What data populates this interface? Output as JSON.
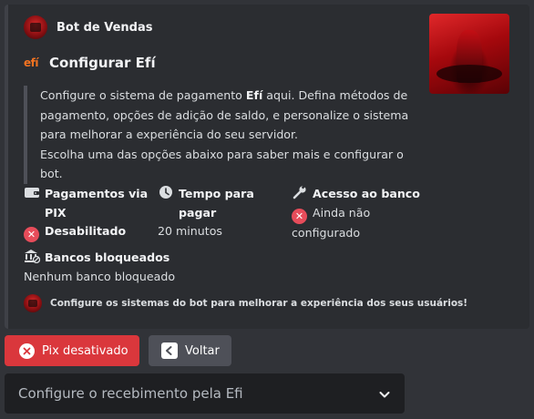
{
  "embed": {
    "author": "Bot de Vendas",
    "title_logo": "efí",
    "title": "Configurar Efí",
    "desc": {
      "p1": "Configure o sistema de pagamento ",
      "p1_bold": "Efí",
      "p1_rest": " aqui. Defina métodos de pagamento, opções de adição de saldo, e personalize o sistema para melhorar a experiência do seu servidor.",
      "p2": "Escolha uma das opções abaixo para saber mais e configurar o bot."
    },
    "fields": {
      "pix": {
        "name": "Pagamentos via PIX",
        "value": "Desabilitado",
        "value_icon": "x-circle-icon"
      },
      "tempo": {
        "name": "Tempo para pagar",
        "value": "20 minutos"
      },
      "acesso": {
        "name": "Acesso ao banco",
        "value": "Ainda não configurado",
        "value_icon": "x-circle-icon"
      },
      "bancos": {
        "name": "Bancos bloqueados",
        "value": "Nenhum banco bloqueado"
      }
    },
    "footer": "Configure os sistemas do bot para melhorar a experiência dos seus usuários!"
  },
  "buttons": {
    "pix": "Pix desativado",
    "back": "Voltar"
  },
  "select": {
    "placeholder": "Configure o recebimento pela Efi"
  },
  "colors": {
    "danger": "#da373c",
    "secondary": "#4e5058",
    "efi_orange": "#f37321",
    "embed_bg": "#2b2d31"
  }
}
